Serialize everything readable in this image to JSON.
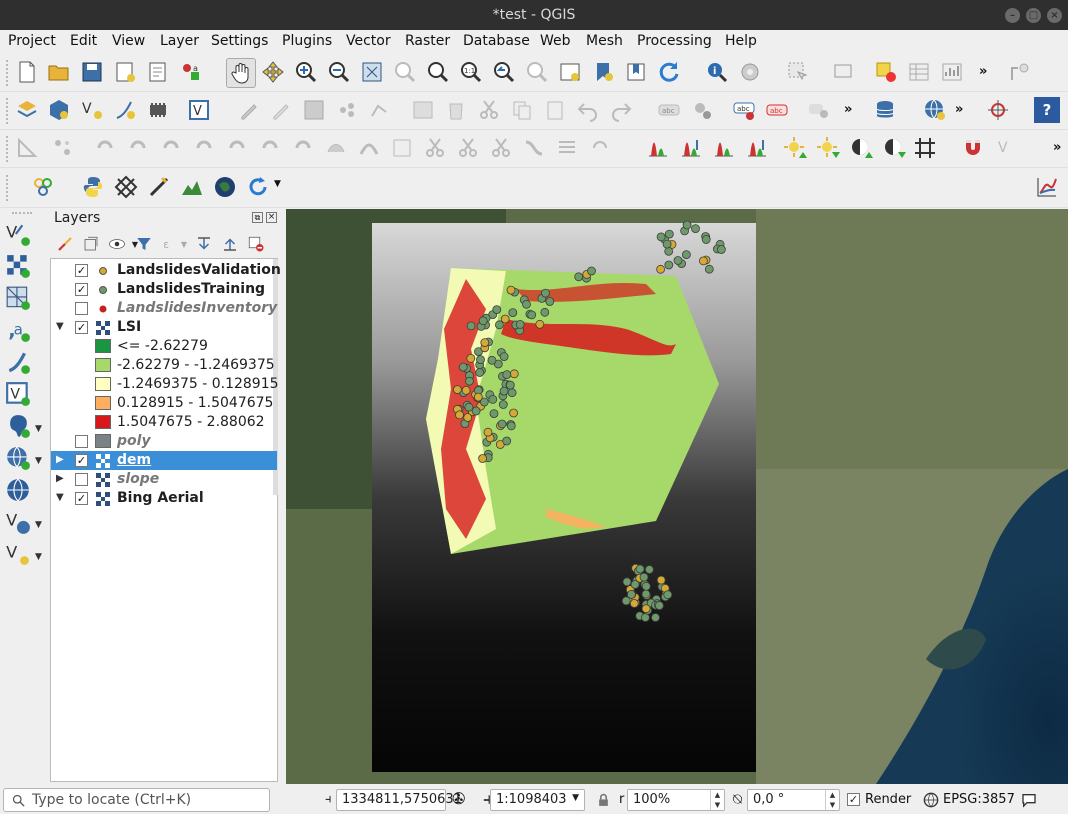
{
  "window": {
    "title": "*test - QGIS"
  },
  "menu": [
    "Project",
    "Edit",
    "View",
    "Layer",
    "Settings",
    "Plugins",
    "Vector",
    "Raster",
    "Database",
    "Web",
    "Mesh",
    "Processing",
    "Help"
  ],
  "layers_panel": {
    "title": "Layers",
    "layers": [
      {
        "name": "LandslidesValidation",
        "checked": "✓",
        "expander": "",
        "symbol_color": "#d4a934"
      },
      {
        "name": "LandslidesTraining",
        "checked": "✓",
        "expander": "",
        "symbol_color": "#6e9a6b"
      },
      {
        "name": "LandslidesInventory",
        "checked": "",
        "expander": "",
        "symbol_color": "#c82020"
      },
      {
        "name": "LSI",
        "checked": "✓",
        "expander": "▼"
      },
      {
        "name": "poly",
        "checked": "",
        "expander": "",
        "symbol_color": "#7b8286"
      },
      {
        "name": "dem",
        "checked": "✓",
        "expander": "▶"
      },
      {
        "name": "slope",
        "checked": "",
        "expander": "▶"
      },
      {
        "name": "Bing Aerial",
        "checked": "✓",
        "expander": "▼"
      }
    ],
    "lsi_legend": [
      {
        "label": "<= -2.62279",
        "color": "#1a9641"
      },
      {
        "label": "-2.62279 - -1.2469375",
        "color": "#a6d96a"
      },
      {
        "label": "-1.2469375 - 0.128915",
        "color": "#ffffc0"
      },
      {
        "label": "0.128915 - 1.5047675",
        "color": "#fdae61"
      },
      {
        "label": "1.5047675 - 2.88062",
        "color": "#d7191c"
      }
    ]
  },
  "statusbar": {
    "locate_placeholder": "Type to locate (Ctrl+K)",
    "coordinate": "1334811,5750631",
    "scale": "1:1098403",
    "magnifier": "100%",
    "rotation": "0,0 °",
    "render_label": "Render",
    "crs": "EPSG:3857"
  },
  "colors": {
    "selected_row": "#3b8fd8",
    "validation_point": "#d4a934",
    "training_point": "#6e9a6b"
  }
}
